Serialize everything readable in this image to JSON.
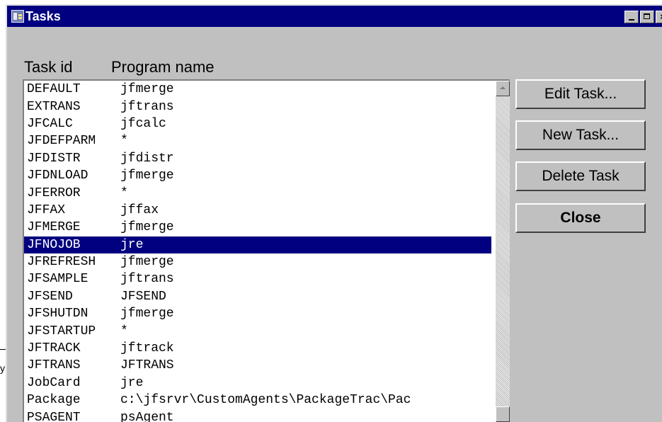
{
  "window": {
    "title": "Tasks"
  },
  "background": {
    "fragment_text": "y"
  },
  "list": {
    "headers": {
      "task_id": "Task id",
      "program_name": "Program name"
    },
    "rows": [
      {
        "id": "DEFAULT",
        "program": "jfmerge"
      },
      {
        "id": "EXTRANS",
        "program": "jftrans"
      },
      {
        "id": "JFCALC",
        "program": "jfcalc"
      },
      {
        "id": "JFDEFPARM",
        "program": "*"
      },
      {
        "id": "JFDISTR",
        "program": "jfdistr"
      },
      {
        "id": "JFDNLOAD",
        "program": "jfmerge"
      },
      {
        "id": "JFERROR",
        "program": "*"
      },
      {
        "id": "JFFAX",
        "program": "jffax"
      },
      {
        "id": "JFMERGE",
        "program": "jfmerge"
      },
      {
        "id": "JFNOJOB",
        "program": "jre",
        "selected": true
      },
      {
        "id": "JFREFRESH",
        "program": "jfmerge"
      },
      {
        "id": "JFSAMPLE",
        "program": "jftrans"
      },
      {
        "id": "JFSEND",
        "program": "JFSEND"
      },
      {
        "id": "JFSHUTDN",
        "program": "jfmerge"
      },
      {
        "id": "JFSTARTUP",
        "program": "*"
      },
      {
        "id": "JFTRACK",
        "program": "jftrack"
      },
      {
        "id": "JFTRANS",
        "program": "JFTRANS"
      },
      {
        "id": "JobCard",
        "program": "jre"
      },
      {
        "id": "Package",
        "program": "c:\\jfsrvr\\CustomAgents\\PackageTrac\\Pac"
      },
      {
        "id": "PSAGENT",
        "program": "psAgent"
      }
    ]
  },
  "buttons": {
    "edit": "Edit Task...",
    "new": "New Task...",
    "delete": "Delete Task",
    "close": "Close"
  },
  "colors": {
    "title_bar": "#000080",
    "selection": "#000080",
    "face": "#c0c0c0"
  }
}
